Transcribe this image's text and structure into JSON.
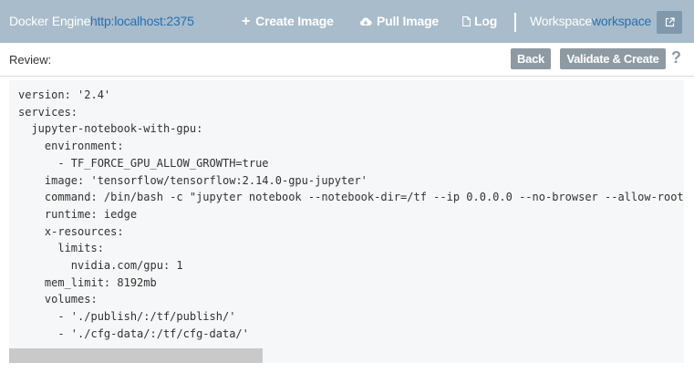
{
  "header": {
    "engine_label": "Docker Engine:",
    "engine_url": "http:localhost:2375",
    "create_image": "Create Image",
    "pull_image": "Pull Image",
    "log": "Log",
    "workspace_label": "Workspace:",
    "workspace_value": "workspace"
  },
  "toolbar": {
    "review_label": "Review:",
    "back_label": "Back",
    "validate_label": "Validate & Create",
    "help_label": "?"
  },
  "editor": {
    "lines": [
      "version: '2.4'",
      "services:",
      "  jupyter-notebook-with-gpu:",
      "    environment:",
      "      - TF_FORCE_GPU_ALLOW_GROWTH=true",
      "    image: 'tensorflow/tensorflow:2.14.0-gpu-jupyter'",
      "    command: /bin/bash -c \"jupyter notebook --notebook-dir=/tf --ip 0.0.0.0 --no-browser --allow-root",
      "    runtime: iedge",
      "    x-resources:",
      "      limits:",
      "        nvidia.com/gpu: 1",
      "    mem_limit: 8192mb",
      "    volumes:",
      "      - './publish/:/tf/publish/'",
      "      - './cfg-data/:/tf/cfg-data/'"
    ]
  },
  "colors": {
    "header_bg": "#a8bccb",
    "link": "#2a6fae",
    "button_bg": "#8e9aa3",
    "editor_bg": "#f6f7f8"
  }
}
